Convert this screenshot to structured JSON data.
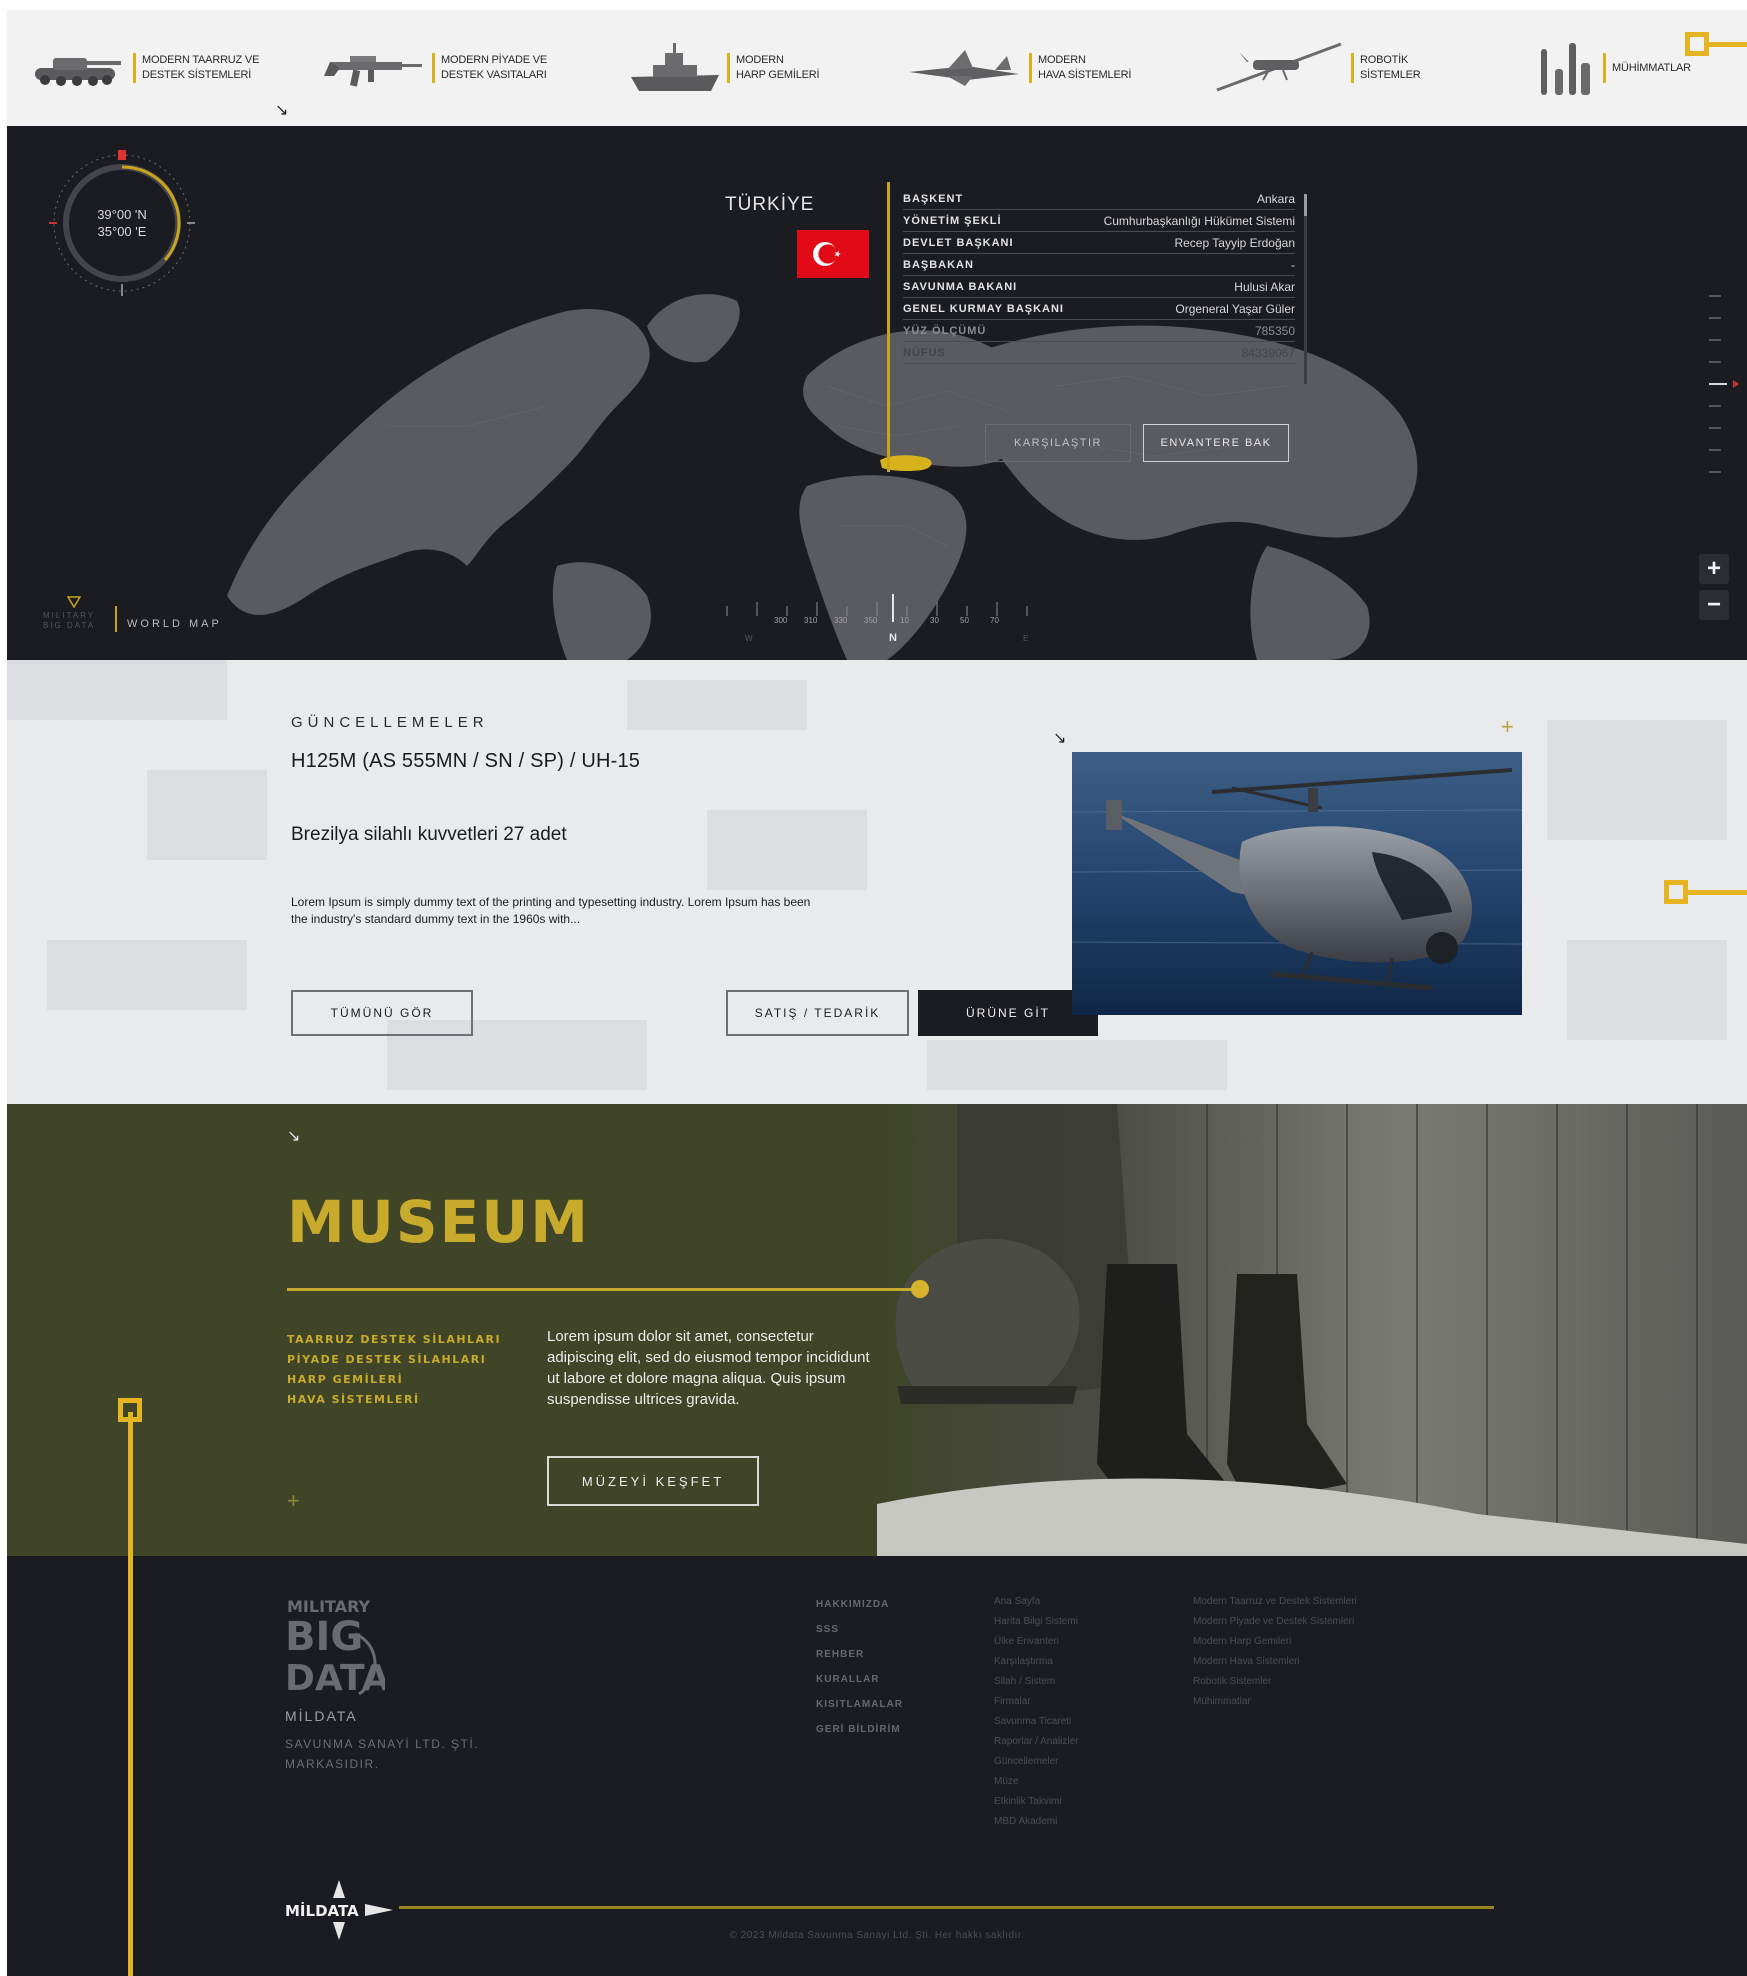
{
  "nav": {
    "categories": [
      {
        "label": "MODERN TAARRUZ VE\nDESTEK SİSTEMLERİ",
        "icon": "tank-icon"
      },
      {
        "label": "MODERN PİYADE VE\nDESTEK VASITALARI",
        "icon": "rifle-icon"
      },
      {
        "label": "MODERN\nHARP GEMİLERİ",
        "icon": "warship-icon"
      },
      {
        "label": "MODERN\nHAVA SİSTEMLERİ",
        "icon": "jet-icon"
      },
      {
        "label": "ROBOTİK\nSİSTEMLER",
        "icon": "drone-icon"
      },
      {
        "label": "MÜHİMMATLAR",
        "icon": "ammo-icon"
      }
    ]
  },
  "map": {
    "coords": {
      "lat": "39°00 'N",
      "lon": "35°00 'E"
    },
    "country": "TÜRKİYE",
    "info": [
      {
        "key": "BAŞKENT",
        "value": "Ankara"
      },
      {
        "key": "YÖNETİM ŞEKLİ",
        "value": "Cumhurbaşkanlığı Hükümet Sistemi"
      },
      {
        "key": "DEVLET BAŞKANI",
        "value": "Recep Tayyip Erdoğan"
      },
      {
        "key": "BAŞBAKAN",
        "value": "-"
      },
      {
        "key": "SAVUNMA BAKANI",
        "value": "Hulusi Akar"
      },
      {
        "key": "GENEL KURMAY BAŞKANI",
        "value": "Orgeneral Yaşar Güler"
      },
      {
        "key": "YÜZ ÖLÇÜMÜ",
        "value": "785350"
      },
      {
        "key": "NÜFUS",
        "value": "84339067"
      }
    ],
    "compare_label": "KARŞILAŞTIR",
    "inventory_label": "ENVANTERE BAK",
    "zoom_in": "+",
    "zoom_out": "−",
    "world_map_label": "WORLD MAP",
    "brand_small": "MILITARY\nBIG DATA",
    "ruler": {
      "w": "W",
      "n": "N",
      "e": "E",
      "ticks": [
        "300",
        "310",
        "330",
        "350",
        "10",
        "30",
        "50",
        "70"
      ]
    }
  },
  "updates": {
    "kicker": "GÜNCELLEMELER",
    "title": "H125M (AS 555MN / SN / SP) / UH-15",
    "subtitle": "Brezilya silahlı kuvvetleri 27 adet",
    "body": "Lorem Ipsum is simply dummy text of the printing and typesetting industry. Lorem Ipsum has been the industry's standard dummy text in the 1960s with...",
    "see_all": "TÜMÜNÜ GÖR",
    "sales": "SATIŞ / TEDARİK",
    "go_product": "ÜRÜNE GİT"
  },
  "museum": {
    "title": "MUSEUM",
    "categories": [
      "TAARRUZ DESTEK SİLAHLARI",
      "PİYADE DESTEK SİLAHLARI",
      "HARP GEMİLERİ",
      "HAVA SİSTEMLERİ"
    ],
    "text": "Lorem ipsum dolor sit amet, consectetur adipiscing elit, sed do eiusmod tempor incididunt ut labore et dolore magna aliqua. Quis ipsum suspendisse ultrices gravida.",
    "button": "MÜZEYİ KEŞFET"
  },
  "footer": {
    "logo_text": "MILITARY BIG DATA",
    "company": "MİLDATA",
    "company_desc": "SAVUNMA SANAYİ LTD. ŞTİ.\nMARKASIDIR.",
    "col1": [
      "HAKKIMIZDA",
      "SSS",
      "REHBER",
      "KURALLAR",
      "KISITLAMALAR",
      "GERİ BİLDİRİM"
    ],
    "col2": [
      "Ana Sayfa",
      "Harita Bilgi Sistemi",
      "Ülke Envanteri",
      "Karşılaştırma",
      "Silah / Sistem",
      "Firmalar",
      "Savunma Ticareti",
      "Raporlar / Analizler",
      "Güncellemeler",
      "Müze",
      "Etkinlik Takvimi",
      "MBD Akademi"
    ],
    "col3": [
      "Modern Taarruz ve Destek Sistemleri",
      "Modern Piyade ve Destek Sistemleri",
      "Modern Harp Gemileri",
      "Modern Hava Sistemleri",
      "Robotik Sistemler",
      "Mühimmatlar"
    ],
    "mark_text": "MİLDATA",
    "copyright": "© 2023 Mildata Savunma Sanayi Ltd. Şti. Her hakkı saklıdır."
  },
  "colors": {
    "accent": "#e4b421",
    "dark": "#1b1c22",
    "olive": "#3f4526",
    "flag_red": "#e30a17"
  }
}
